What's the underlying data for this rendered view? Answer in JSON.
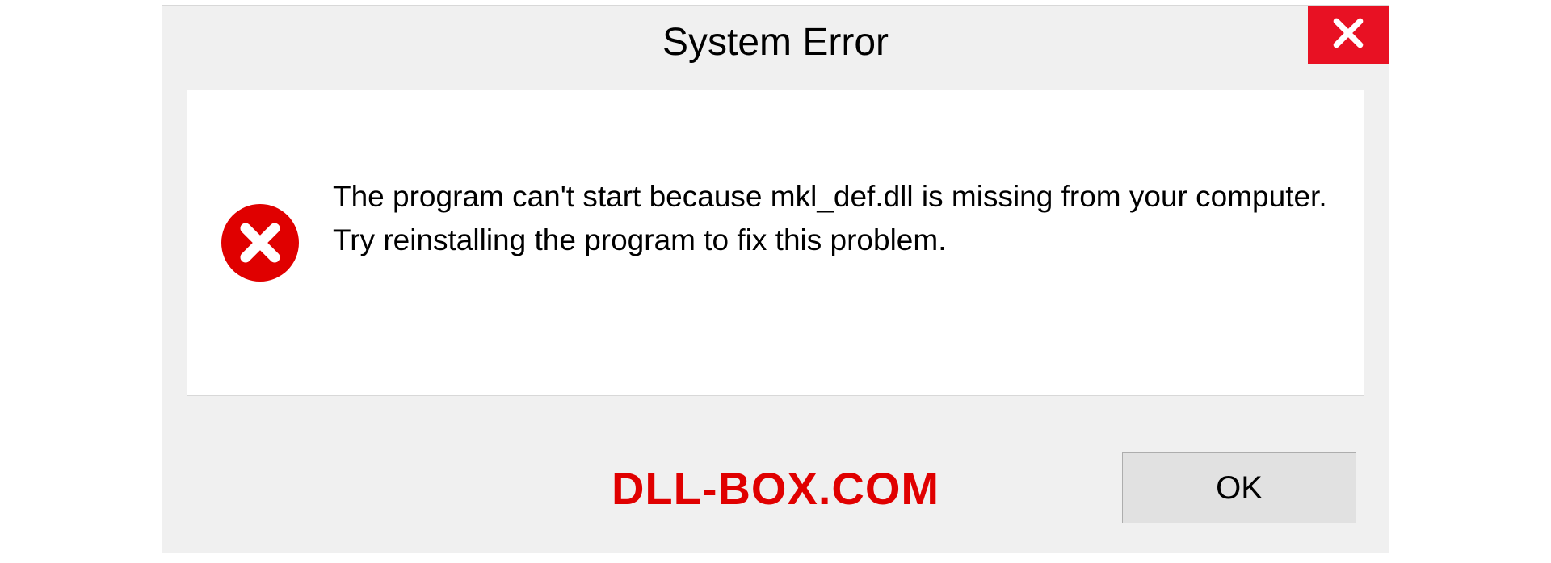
{
  "titlebar": {
    "title": "System Error"
  },
  "message": {
    "line1": "The program can't start because mkl_def.dll is missing from your computer.",
    "line2": "Try reinstalling the program to fix this problem."
  },
  "footer": {
    "watermark": "DLL-BOX.COM",
    "ok_label": "OK"
  }
}
